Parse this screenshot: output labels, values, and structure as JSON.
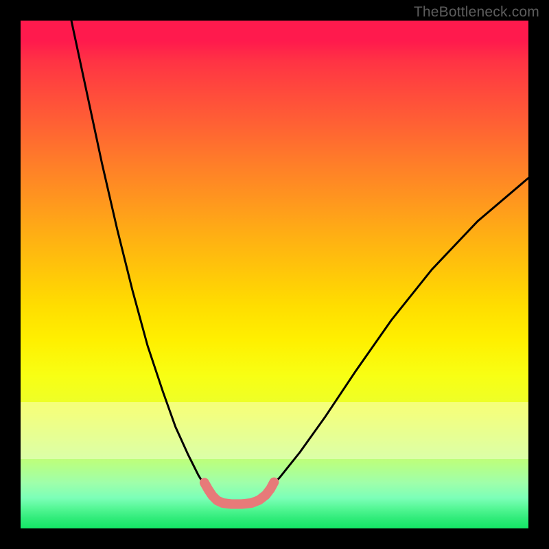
{
  "watermark": "TheBottleneck.com",
  "colors": {
    "background": "#000000",
    "curve_stroke": "#000000",
    "marker_stroke": "#e77a79",
    "gradient_top": "#ff1a4d",
    "gradient_bottom": "#14e666"
  },
  "chart_data": {
    "type": "line",
    "title": "",
    "xlabel": "",
    "ylabel": "",
    "xlim": [
      0,
      100
    ],
    "ylim": [
      0,
      100
    ],
    "note": "Axes are unlabeled in the image; values below are estimated by normalizing pixel positions onto a 0–100 scale where x=0 is left, y=0 is bottom.",
    "series": [
      {
        "name": "left-curve",
        "x": [
          10.0,
          13.0,
          16.0,
          19.0,
          22.0,
          25.0,
          28.0,
          30.5,
          33.0,
          35.0,
          36.5,
          38.0
        ],
        "y": [
          100.0,
          86.0,
          72.0,
          59.0,
          47.0,
          36.0,
          27.0,
          20.0,
          14.5,
          10.5,
          8.0,
          6.5
        ]
      },
      {
        "name": "right-curve",
        "x": [
          48.0,
          51.0,
          55.0,
          60.0,
          66.0,
          73.0,
          81.0,
          90.0,
          100.0
        ],
        "y": [
          7.0,
          10.0,
          15.0,
          22.0,
          31.0,
          41.0,
          51.0,
          60.5,
          69.0
        ]
      },
      {
        "name": "valley-marker",
        "x": [
          36.2,
          37.0,
          37.8,
          38.7,
          39.8,
          41.5,
          43.5,
          45.5,
          47.0,
          48.3,
          49.2,
          49.9
        ],
        "y": [
          9.0,
          7.6,
          6.4,
          5.5,
          5.0,
          4.8,
          4.8,
          5.0,
          5.6,
          6.6,
          7.8,
          9.1
        ]
      }
    ]
  }
}
